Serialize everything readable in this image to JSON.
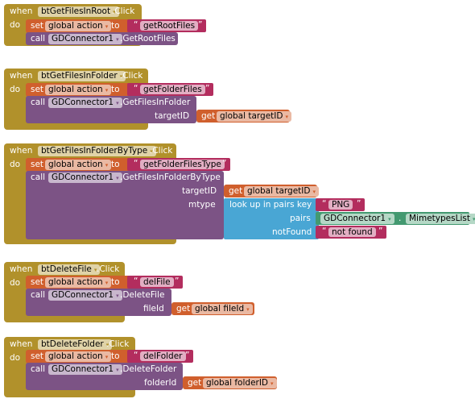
{
  "keywords": {
    "when": "when",
    "do": "do",
    "click": ".Click",
    "set": "set",
    "to": "to",
    "call": "call",
    "get": "get",
    "open_quote": "“",
    "close_quote": "”",
    "dot": ".",
    "lookup": "look up in pairs  key",
    "pairs": "pairs",
    "notFound": "notFound",
    "dropdown": "▾"
  },
  "colors": {
    "event": "#B1912B",
    "variable": "#D05F2D",
    "text": "#B32D5E",
    "procedure": "#7C5385",
    "lookup": "#49A6D4",
    "component": "#439970"
  },
  "blocks": [
    {
      "component": "btGetFilesInRoot",
      "set_var": "global action",
      "text_value": "getRootFiles",
      "call_component": "GDConnector1",
      "method": ".GetRootFiles"
    },
    {
      "component": "btGetFilesInFolder",
      "set_var": "global action",
      "text_value": "getFolderFiles",
      "call_component": "GDConnector1",
      "method": ".GetFilesInFolder",
      "arg_name": "targetID",
      "arg_var": "global targetID"
    },
    {
      "component": "btGetFilesInFolderByType",
      "set_var": "global action",
      "text_value": "getFolderFilesType",
      "call_component": "GDConnector1",
      "method": ".GetFilesInFolderByType",
      "arg_name": "targetID",
      "arg_var": "global targetID",
      "arg2_name": "mtype",
      "lookup_key": "PNG",
      "pairs_component": "GDConnector1",
      "pairs_property": "MimetypesList",
      "not_found": "not found"
    },
    {
      "component": "btDeleteFile",
      "set_var": "global action",
      "text_value": "delFile",
      "call_component": "GDConnector1",
      "method": ".DeleteFile",
      "arg_name": "fileId",
      "arg_var": "global fileId"
    },
    {
      "component": "btDeleteFolder",
      "set_var": "global action",
      "text_value": "delFolder",
      "call_component": "GDConnector1",
      "method": ".DeleteFolder",
      "arg_name": "folderId",
      "arg_var": "global folderID"
    }
  ]
}
